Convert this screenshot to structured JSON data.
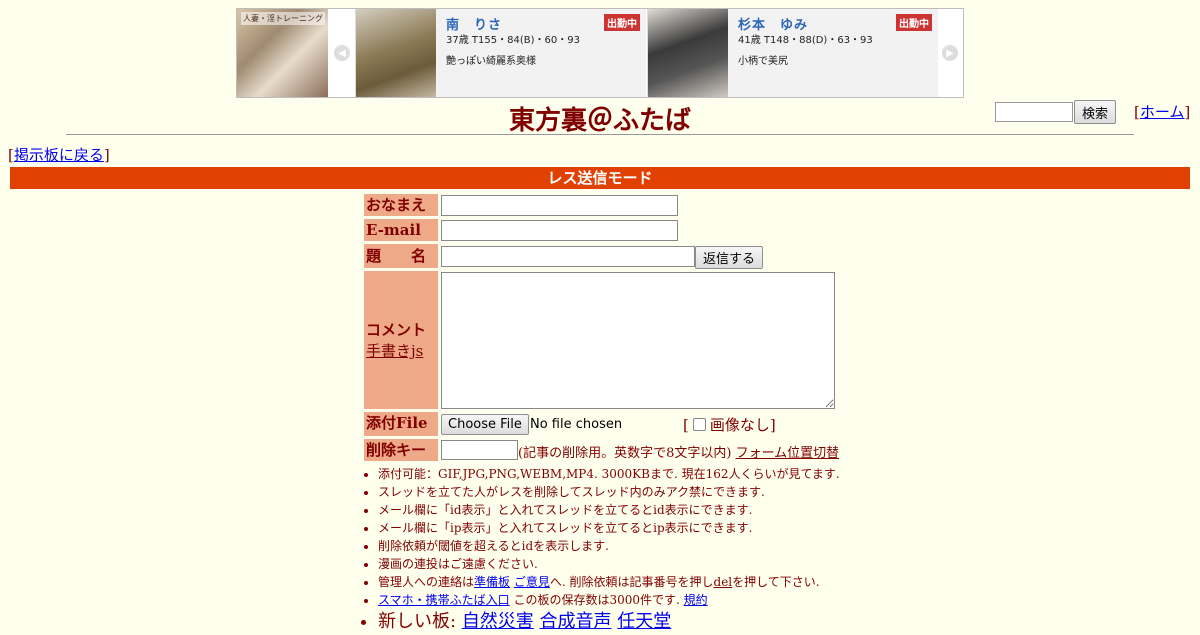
{
  "ad": {
    "thumb_text": "人妻・淫トレーニング",
    "cards": [
      {
        "name": "南　りさ",
        "badge": "出勤中",
        "stats": "37歳 T155・84(B)・60・93",
        "desc": "艶っぽい綺麗系奥様"
      },
      {
        "name": "杉本　ゆみ",
        "badge": "出勤中",
        "stats": "41歳 T148・88(D)・63・93",
        "desc": "小柄で美尻"
      }
    ]
  },
  "header": {
    "title": "東方裏＠ふたば",
    "search_button": "検索",
    "home_link": "ホーム"
  },
  "nav": {
    "back_link": "掲示板に戻る"
  },
  "form": {
    "mode_title": "レス送信モード",
    "labels": {
      "name": "おなまえ",
      "email": "E-mail",
      "subject": "題　　名",
      "comment": "コメント",
      "handwriting": "手書きjs",
      "file": "添付File",
      "delete_key": "削除キー"
    },
    "submit_button": "返信する",
    "file_button": "Choose File",
    "file_status": "No file chosen",
    "no_image": "画像なし",
    "delete_note": "(記事の削除用。英数字で8文字以内)",
    "form_position_link": "フォーム位置切替"
  },
  "notes": {
    "n1": "添付可能：GIF,JPG,PNG,WEBM,MP4. 3000KBまで. 現在162人くらいが見てます.",
    "n2": "スレッドを立てた人がレスを削除してスレッド内のみアク禁にできます.",
    "n3": "メール欄に「id表示」と入れてスレッドを立てるとid表示にできます.",
    "n4": "メール欄に「ip表示」と入れてスレッドを立てるとip表示にできます.",
    "n5": "削除依頼が閾値を超えるとidを表示します.",
    "n6": "漫画の連投はご遠慮ください.",
    "n7_pre": "管理人への連絡は",
    "n7_link1": "準備板",
    "n7_link2": "ご意見",
    "n7_mid": "へ. 削除依頼は記事番号を押し",
    "n7_link3": "del",
    "n7_post": "を押して下さい.",
    "n8_link1": "スマホ・携帯ふたば入口",
    "n8_mid": "この板の保存数は3000件です.",
    "n8_link2": "規約",
    "n9_pre": "新しい板:",
    "n9_link1": "自然災害",
    "n9_link2": "合成音声",
    "n9_link3": "任天堂"
  }
}
